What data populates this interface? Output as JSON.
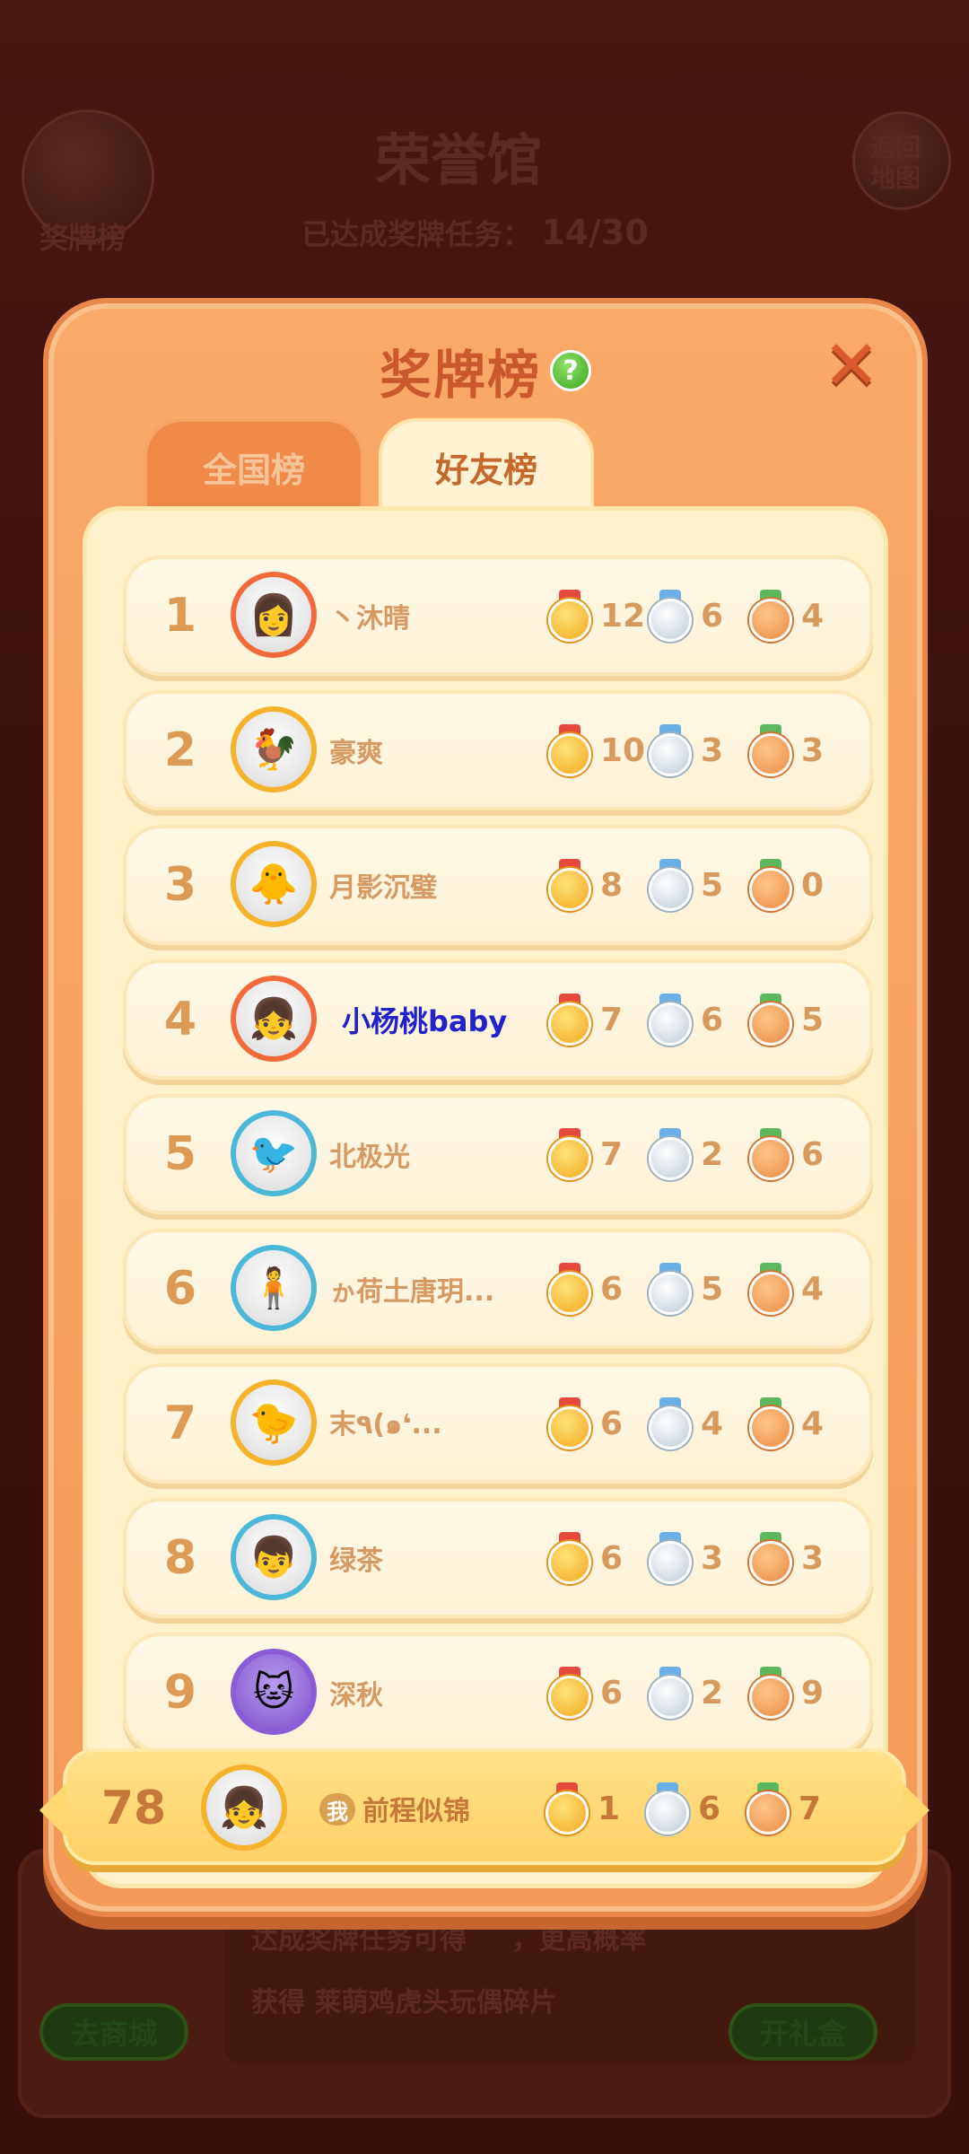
{
  "background": {
    "left_button_label": "奖牌榜",
    "hall_title": "荣誉馆",
    "right_button_label": "返回地图",
    "task_progress_label": "已达成奖牌任务：",
    "task_progress_value": "14/30",
    "hint_line1": "达成奖牌任务可得",
    "hint_line1_suffix": "，更高概率",
    "hint_line2_prefix": "获得",
    "hint_line2_item": "莱萌鸡虎头玩偶碎片",
    "shop_button": "去商城",
    "gift_button": "开礼盒"
  },
  "modal": {
    "title": "奖牌榜",
    "help": "?",
    "close": "✕",
    "tabs": [
      {
        "label": "全国榜",
        "active": false
      },
      {
        "label": "好友榜",
        "active": true
      }
    ]
  },
  "colors": {
    "gold_medal": "#f4a81e",
    "silver_medal": "#bcc9d6",
    "bronze_medal": "#e98a42",
    "modal_bg": "#f7a562",
    "row_bg": "#fff5df"
  },
  "leaderboard": [
    {
      "rank": "1",
      "name": "丶沐晴",
      "avatar_icon": "tiger-frame-avatar",
      "gold": "12",
      "silver": "6",
      "bronze": "4"
    },
    {
      "rank": "2",
      "name": "豪爽",
      "avatar_icon": "rooster-frame-avatar",
      "gold": "10",
      "silver": "3",
      "bronze": "3"
    },
    {
      "rank": "3",
      "name": "月影沉璧",
      "avatar_icon": "chicken-4000-avatar",
      "gold": "8",
      "silver": "5",
      "bronze": "0"
    },
    {
      "rank": "4",
      "name": "小杨桃baby",
      "avatar_icon": "tiger-frame-avatar",
      "gold": "7",
      "silver": "6",
      "bronze": "5"
    },
    {
      "rank": "5",
      "name": "北极光",
      "avatar_icon": "blue-bird-avatar",
      "gold": "7",
      "silver": "2",
      "bronze": "6"
    },
    {
      "rank": "6",
      "name": "ゕ荷土唐玥...",
      "avatar_icon": "lotus-frame-avatar",
      "gold": "6",
      "silver": "5",
      "bronze": "4"
    },
    {
      "rank": "7",
      "name": "末٩(๑❛...",
      "avatar_icon": "chick-avatar",
      "gold": "6",
      "silver": "4",
      "bronze": "4"
    },
    {
      "rank": "8",
      "name": "绿茶",
      "avatar_icon": "lotus-frame-avatar",
      "gold": "6",
      "silver": "3",
      "bronze": "3"
    },
    {
      "rank": "9",
      "name": "深秋",
      "avatar_icon": "purple-cat-avatar",
      "gold": "6",
      "silver": "2",
      "bronze": "9"
    }
  ],
  "me": {
    "rank": "78",
    "badge": "我",
    "name": "前程似锦",
    "avatar_icon": "cartoon-girl-avatar",
    "gold": "1",
    "silver": "6",
    "bronze": "7"
  }
}
